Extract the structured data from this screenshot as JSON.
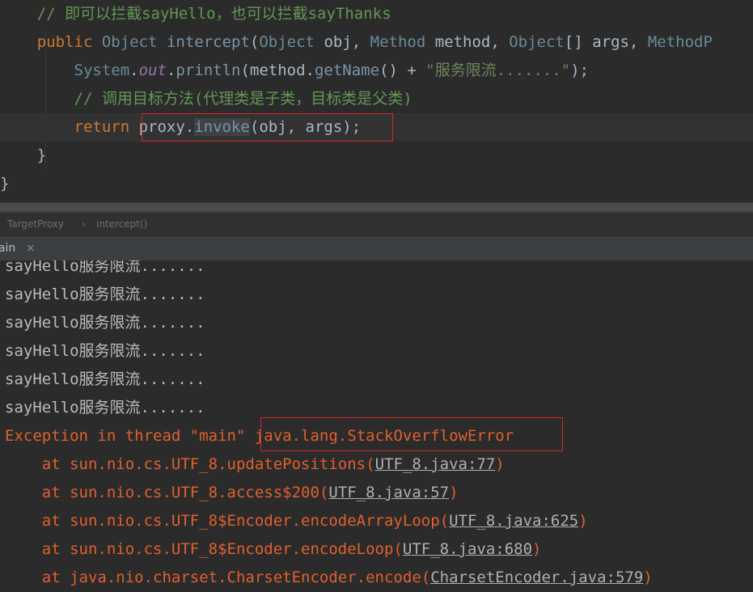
{
  "editor": {
    "comment1": "// 即可以拦截sayHello，也可以拦截sayThanks",
    "sig": {
      "kw_public": "public",
      "type_object": "Object",
      "method_name": "intercept",
      "paren_open": "(",
      "p1_type": "Object",
      "p1_name": " obj, ",
      "p2_type": "Method",
      "p2_name": " method, ",
      "p3_type": "Object",
      "p3_name": "[] args, ",
      "p4_type": "MethodP"
    },
    "print": {
      "system": "System",
      "dot1": ".",
      "out": "out",
      "dot2": ".",
      "println": "println",
      "open": "(method.",
      "getname": "getName",
      "concat": "() + ",
      "str": "\"服务限流.......\"",
      "close": ");"
    },
    "comment2": "// 调用目标方法(代理类是子类，目标类是父类)",
    "ret": {
      "kw_return": "return",
      "proxy": " proxy.",
      "invoke": "invoke",
      "args": "(obj, args);"
    },
    "brace_inner": "}",
    "brace_outer": "}"
  },
  "breadcrumb": {
    "class_name": "TargetProxy",
    "separator": "›",
    "method": "intercept()"
  },
  "run_tab": {
    "label": "lain",
    "close": "×"
  },
  "console": {
    "lines": [
      "sayHello服务限流.......",
      "sayHello服务限流.......",
      "sayHello服务限流.......",
      "sayHello服务限流.......",
      "sayHello服务限流.......",
      "sayHello服务限流......."
    ],
    "exception_prefix": "Exception in thread \"main\" ",
    "exception_type": "java.lang.StackOverflowError",
    "stack": [
      {
        "at": "    at sun.nio.cs.UTF_8.updatePositions(",
        "link": "UTF_8.java:77",
        "end": ")"
      },
      {
        "at": "    at sun.nio.cs.UTF_8.access$200(",
        "link": "UTF_8.java:57",
        "end": ")"
      },
      {
        "at": "    at sun.nio.cs.UTF_8$Encoder.encodeArrayLoop(",
        "link": "UTF_8.java:625",
        "end": ")"
      },
      {
        "at": "    at sun.nio.cs.UTF_8$Encoder.encodeLoop(",
        "link": "UTF_8.java:680",
        "end": ")"
      },
      {
        "at": "    at java.nio.charset.CharsetEncoder.encode(",
        "link": "CharsetEncoder.java:579",
        "end": ")"
      }
    ]
  },
  "colors": {
    "background": "#2b2b2b",
    "keyword": "#cc7832",
    "comment": "#629755",
    "string": "#6a8759",
    "error": "#e0602e",
    "highlight_box": "#d12a2a"
  }
}
